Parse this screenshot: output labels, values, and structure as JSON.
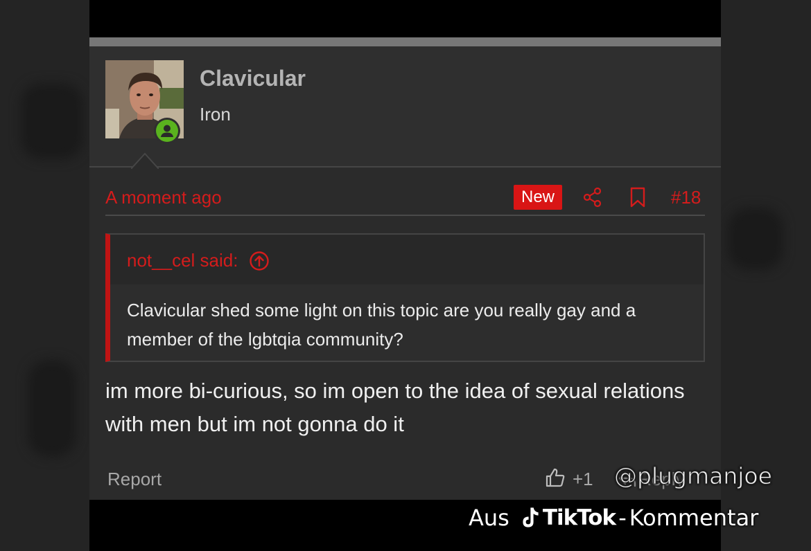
{
  "post": {
    "author": "Clavicular",
    "author_title": "Iron",
    "avatar_icon": "user-avatar-photo",
    "online_icon": "online-user-icon",
    "time": "A moment ago",
    "new_badge": "New",
    "post_number": "#18",
    "share_icon": "share-icon",
    "bookmark_icon": "bookmark-icon",
    "quote": {
      "author": "not__cel said:",
      "body": "Clavicular shed some light on this topic are you really gay and a member of the lgbtqia community?"
    },
    "message": "im more bi-curious, so im open to the idea of sexual relations with men but im not gonna do it",
    "footer": {
      "report": "Report",
      "like_count": "+1",
      "reply": "Reply"
    }
  },
  "watermark": {
    "handle": "@plugmanjoe",
    "prefix": "Aus",
    "brand": "TikTok",
    "separator": "-",
    "suffix": "Kommentar"
  },
  "colors": {
    "accent_red": "#d41c1c",
    "badge_red": "#d91515",
    "online_green": "#5ab31e",
    "panel": "#2b2b2b"
  }
}
